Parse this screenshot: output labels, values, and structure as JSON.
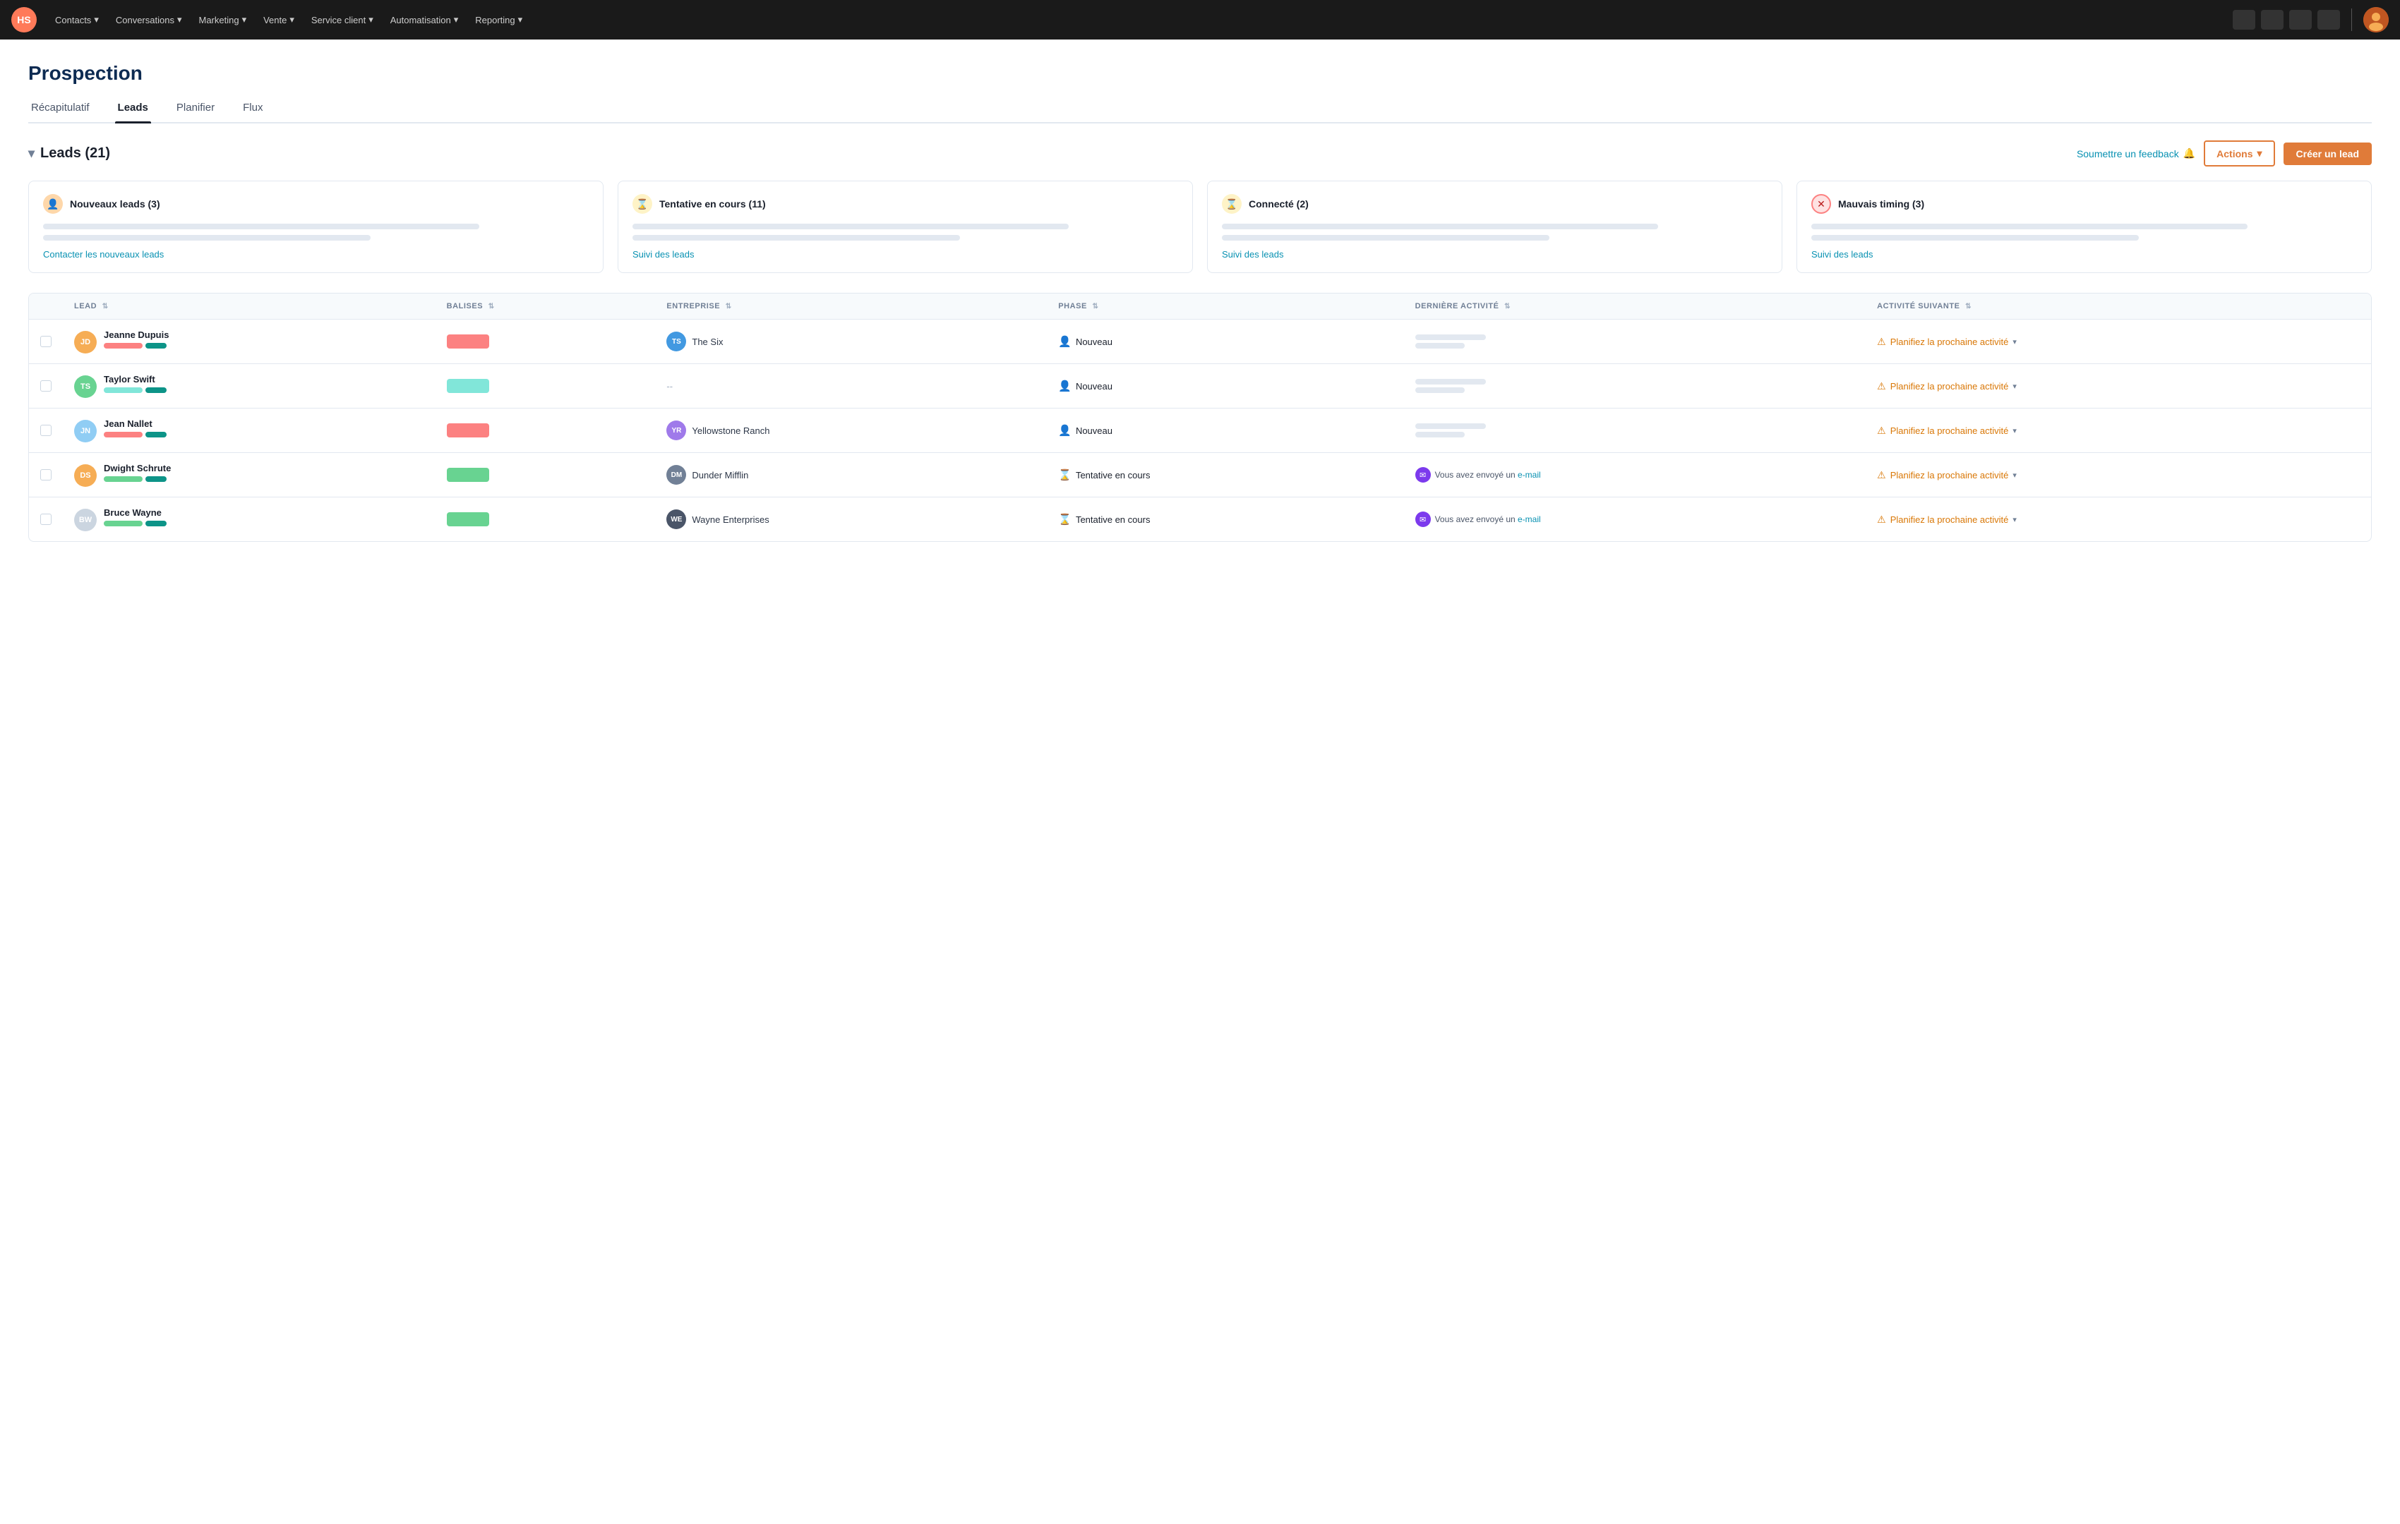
{
  "app": {
    "logo": "HS"
  },
  "navbar": {
    "items": [
      {
        "label": "Contacts",
        "id": "contacts"
      },
      {
        "label": "Conversations",
        "id": "conversations"
      },
      {
        "label": "Marketing",
        "id": "marketing"
      },
      {
        "label": "Vente",
        "id": "vente"
      },
      {
        "label": "Service client",
        "id": "service-client"
      },
      {
        "label": "Automatisation",
        "id": "automatisation"
      },
      {
        "label": "Reporting",
        "id": "reporting"
      }
    ]
  },
  "page": {
    "title": "Prospection"
  },
  "tabs": [
    {
      "label": "Récapitulatif",
      "active": false
    },
    {
      "label": "Leads",
      "active": true
    },
    {
      "label": "Planifier",
      "active": false
    },
    {
      "label": "Flux",
      "active": false
    }
  ],
  "leads_section": {
    "title": "Leads (21)",
    "feedback_label": "Soumettre un feedback",
    "actions_label": "Actions",
    "create_label": "Créer un lead"
  },
  "cards": [
    {
      "id": "nouveaux",
      "icon_type": "person",
      "icon_symbol": "👤",
      "title": "Nouveaux leads (3)",
      "link_label": "Contacter les nouveaux leads"
    },
    {
      "id": "tentative",
      "icon_type": "hourglass",
      "icon_symbol": "⌛",
      "title": "Tentative en cours (11)",
      "link_label": "Suivi des leads"
    },
    {
      "id": "connecte",
      "icon_type": "connected",
      "icon_symbol": "⌛",
      "title": "Connecté (2)",
      "link_label": "Suivi des leads"
    },
    {
      "id": "mauvais",
      "icon_type": "bad",
      "icon_symbol": "✕",
      "title": "Mauvais timing (3)",
      "link_label": "Suivi des leads"
    }
  ],
  "table": {
    "columns": [
      {
        "label": "Lead",
        "id": "lead"
      },
      {
        "label": "Balises",
        "id": "balises"
      },
      {
        "label": "Entreprise",
        "id": "entreprise"
      },
      {
        "label": "Phase",
        "id": "phase"
      },
      {
        "label": "Dernière Activité",
        "id": "derniere-activite"
      },
      {
        "label": "Activité Suivante",
        "id": "activite-suivante"
      }
    ],
    "rows": [
      {
        "id": "row-1",
        "initials": "JD",
        "avatar_color": "#f6ad55",
        "name": "Jeanne Dupuis",
        "tag_color": "#fc8181",
        "company_initials": "TS",
        "company_color": "#4299e1",
        "company": "The Six",
        "phase": "Nouveau",
        "phase_icon": "person",
        "phase_icon_color": "#e53e3e",
        "last_activity_type": "bar",
        "next_activity": "Planifiez la prochaine activité"
      },
      {
        "id": "row-2",
        "initials": "TS",
        "avatar_color": "#68d391",
        "name": "Taylor Swift",
        "tag_color": "#81e6d9",
        "company_initials": "--",
        "company_color": "#a0aec0",
        "company": "--",
        "phase": "Nouveau",
        "phase_icon": "person",
        "phase_icon_color": "#e53e3e",
        "last_activity_type": "bar",
        "next_activity": "Planifiez la prochaine activité"
      },
      {
        "id": "row-3",
        "initials": "JN",
        "avatar_color": "#90cdf4",
        "name": "Jean Nallet",
        "tag_color": "#fc8181",
        "company_initials": "YR",
        "company_color": "#9f7aea",
        "company": "Yellowstone Ranch",
        "phase": "Nouveau",
        "phase_icon": "person",
        "phase_icon_color": "#e53e3e",
        "last_activity_type": "bar",
        "next_activity": "Planifiez la prochaine activité"
      },
      {
        "id": "row-4",
        "initials": "DS",
        "avatar_color": "#f6ad55",
        "name": "Dwight Schrute",
        "tag_color": "#68d391",
        "company_initials": "DM",
        "company_color": "#718096",
        "company": "Dunder Mifflin",
        "phase": "Tentative en cours",
        "phase_icon": "hourglass",
        "phase_icon_color": "#d97706",
        "last_activity_type": "email",
        "last_activity_text": "Vous avez envoyé un",
        "last_activity_link": "e-mail",
        "next_activity": "Planifiez la prochaine activité"
      },
      {
        "id": "row-5",
        "initials": "BW",
        "avatar_color": "#cbd5e0",
        "name": "Bruce Wayne",
        "tag_color": "#68d391",
        "company_initials": "WE",
        "company_color": "#4a5568",
        "company": "Wayne Enterprises",
        "phase": "Tentative en cours",
        "phase_icon": "hourglass",
        "phase_icon_color": "#d97706",
        "last_activity_type": "email",
        "last_activity_text": "Vous avez envoyé un",
        "last_activity_link": "e-mail",
        "next_activity": "Planifiez la prochaine activité"
      }
    ]
  }
}
